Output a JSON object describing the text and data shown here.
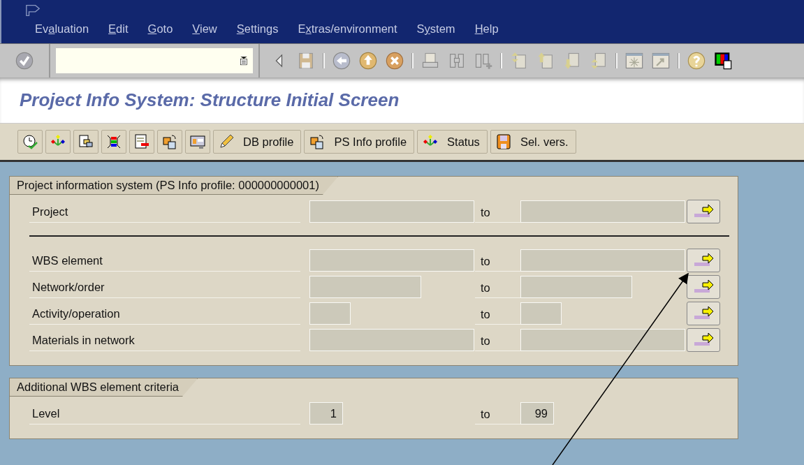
{
  "menu_bar": {
    "items": [
      {
        "before": "Ev",
        "mnemonic": "a",
        "after": "luation"
      },
      {
        "mnemonic": "E",
        "after": "dit"
      },
      {
        "mnemonic": "G",
        "after": "oto"
      },
      {
        "mnemonic": "V",
        "after": "iew"
      },
      {
        "mnemonic": "S",
        "after": "ettings"
      },
      {
        "before": "E",
        "mnemonic": "x",
        "after": "tras/environment"
      },
      {
        "before": "S",
        "mnemonic": "y",
        "after": "stem"
      },
      {
        "mnemonic": "H",
        "after": "elp"
      }
    ]
  },
  "screen_title": "Project Info System: Structure Initial Screen",
  "app_toolbar": {
    "text_buttons": [
      {
        "label": "DB profile"
      },
      {
        "label": "PS Info profile"
      },
      {
        "label": "Status"
      },
      {
        "label": "Sel. vers."
      }
    ]
  },
  "panels": [
    {
      "title": "Project information system (PS Info profile: 000000000001)",
      "groups": [
        [
          {
            "label": "Project",
            "to_label": "to",
            "multi_select": true
          }
        ],
        [
          {
            "label": "WBS element",
            "to_label": "to",
            "multi_select": true
          },
          {
            "label": "Network/order",
            "to_label": "to",
            "multi_select": true
          },
          {
            "label": "Activity/operation",
            "to_label": "to",
            "multi_select": true
          },
          {
            "label": "Materials in network",
            "to_label": "to",
            "multi_select": true
          }
        ]
      ]
    },
    {
      "title": "Additional WBS element criteria",
      "groups": [
        [
          {
            "label": "Level",
            "low": "1",
            "to_label": "to",
            "high": "99",
            "multi_select": false
          }
        ]
      ]
    }
  ],
  "annotation": {
    "kind": "arrow"
  }
}
